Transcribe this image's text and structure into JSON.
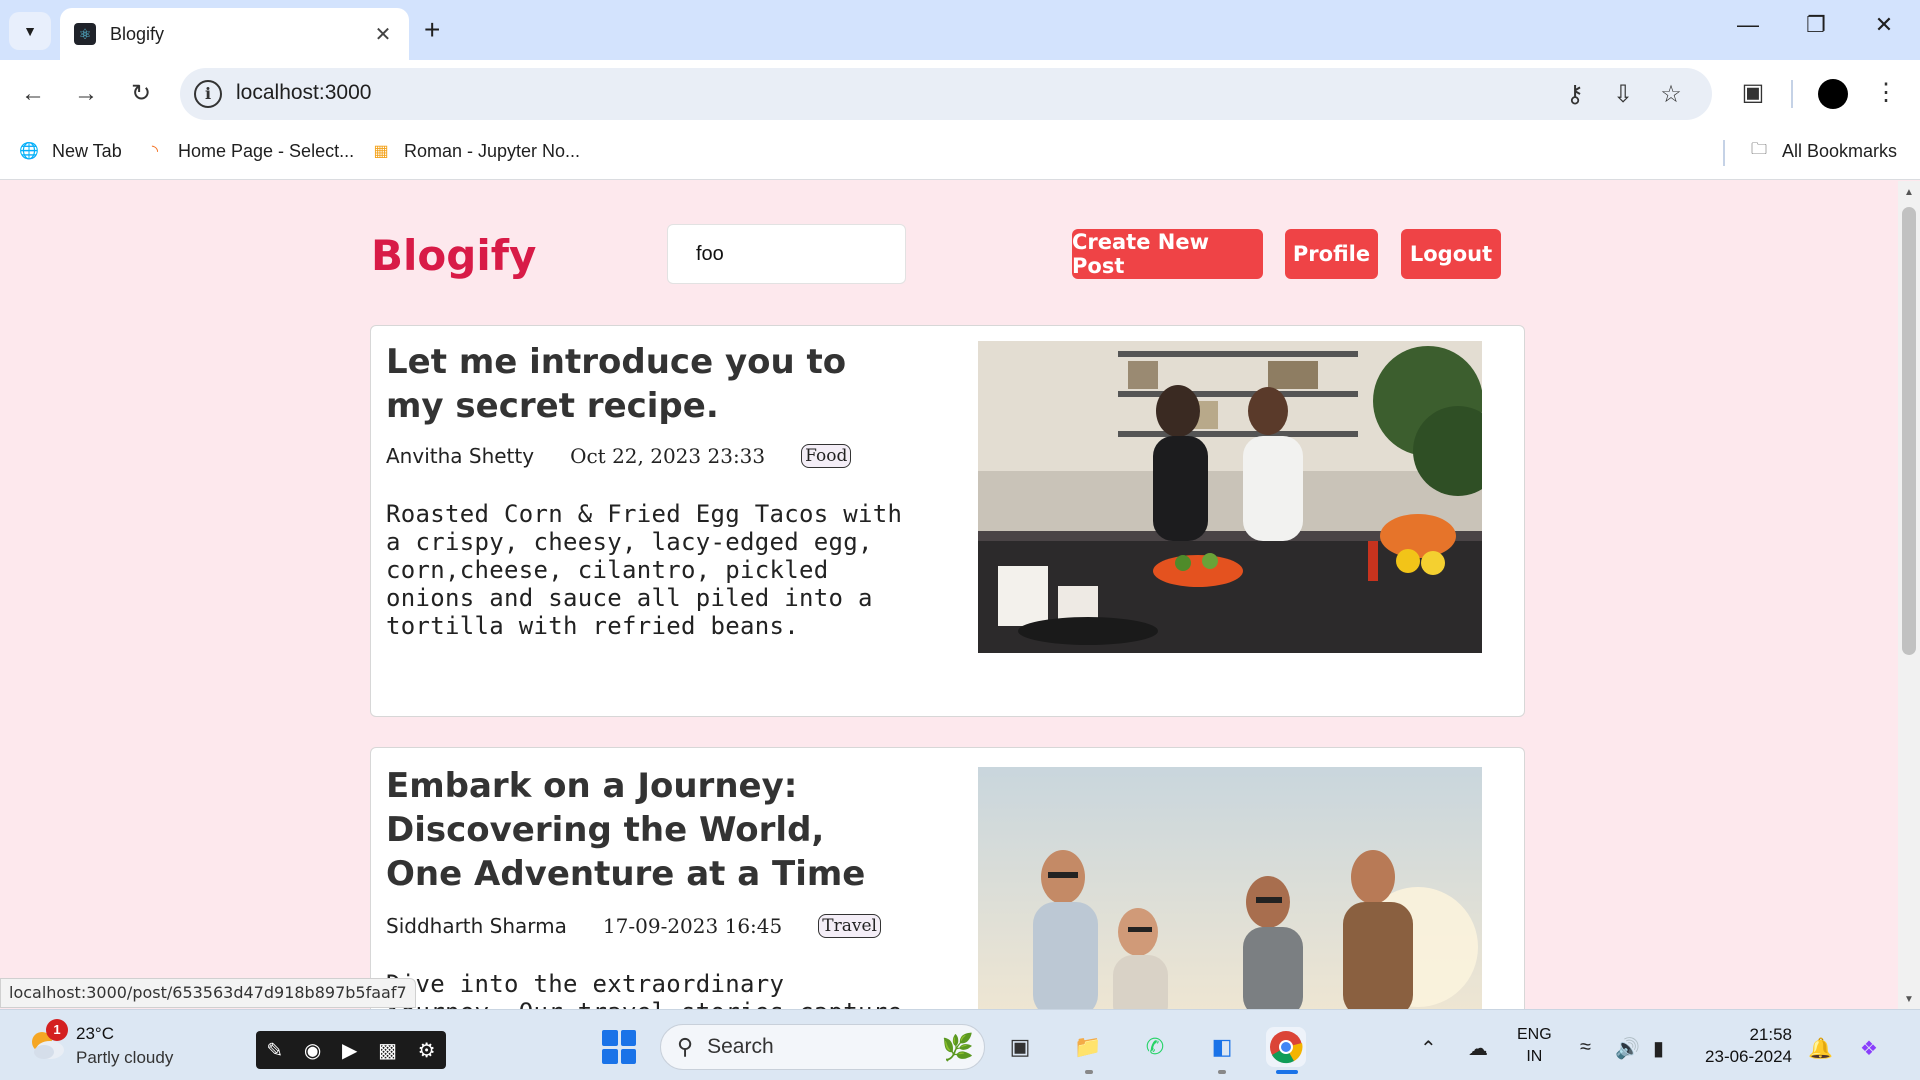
{
  "browser": {
    "tab_title": "Blogify",
    "url": "localhost:3000",
    "bookmarks": [
      {
        "label": "New Tab"
      },
      {
        "label": "Home Page - Select..."
      },
      {
        "label": "Roman - Jupyter No..."
      }
    ],
    "all_bookmarks": "All Bookmarks"
  },
  "header": {
    "brand": "Blogify",
    "search_value": "foo",
    "buttons": {
      "create": "Create New Post",
      "profile": "Profile",
      "logout": "Logout"
    }
  },
  "posts": [
    {
      "title": "Let me introduce you to my secret recipe.",
      "author": "Anvitha Shetty",
      "date": "Oct 22, 2023 23:33",
      "tag": "Food",
      "excerpt": "Roasted Corn & Fried Egg Tacos with a crispy, cheesy, lacy-edged egg, corn,cheese, cilantro, pickled onions and sauce all piled into a tortilla with refried beans."
    },
    {
      "title": "Embark on a Journey: Discovering the World, One Adventure at a Time",
      "author": "Siddharth Sharma",
      "date": "17-09-2023 16:45",
      "tag": "Travel",
      "excerpt": "Dive into the extraordinary journey. Our travel stories capture the essence of"
    }
  ],
  "status_bar": {
    "hover_url": "localhost:3000/post/653563d47d918b897b5faaf7"
  },
  "taskbar": {
    "weather_badge": "1",
    "temperature": "23°C",
    "condition": "Partly cloudy",
    "search_label": "Search",
    "lang_top": "ENG",
    "lang_bottom": "IN",
    "time": "21:58",
    "date": "23-06-2024"
  },
  "icons": {
    "tab_favicon": "react-icon",
    "back": "arrow-left-icon",
    "forward": "arrow-right-icon",
    "reload": "reload-icon",
    "info": "info-icon",
    "password": "key-icon",
    "install": "install-icon",
    "bookmark": "star-icon",
    "extensions": "puzzle-icon",
    "menu": "kebab-icon"
  },
  "colors": {
    "brand": "#d81b47",
    "button": "#ef4346",
    "page_bg": "#fde8ed"
  }
}
